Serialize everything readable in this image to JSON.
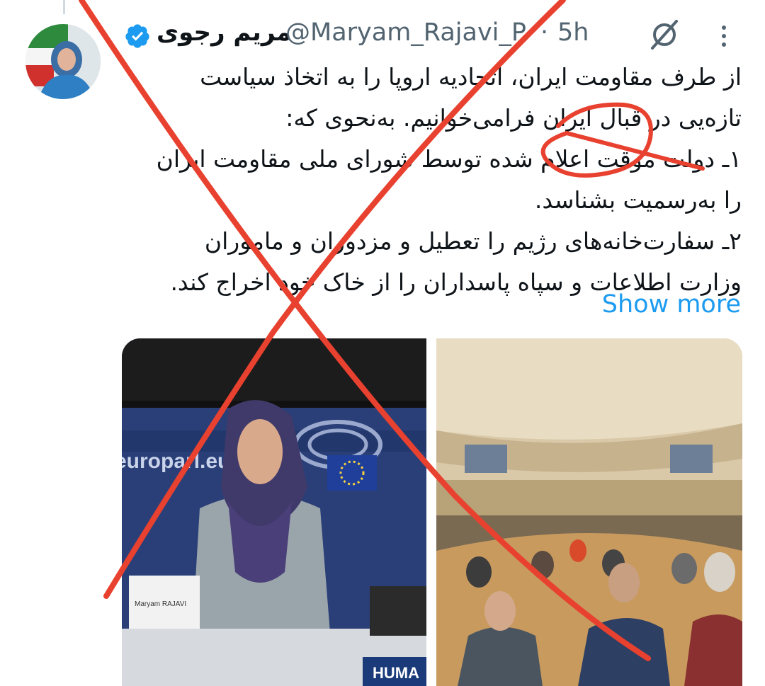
{
  "tweet": {
    "display_name": "مریم رجوی",
    "handle": "@Maryam_Rajavi_P",
    "separator": "·",
    "time": "5h",
    "text": "از طرف مقاومت ایران، اتحادیه اروپا را به اتخاذ سیاست\nتازه‌یی در قبال ایران فرامی‌خوانیم. به‌نحوی که:\n۱ـ دولت موقت اعلام شده توسط شورای ملی مقاومت ایران\nرا به‌رسمیت بشناسد.\n۲ـ سفارت‌خانه‌های رژیم را تعطیل و مزدوران و ماموران\nوزارت اطلاعات و سپاه پاسداران را از خاک خود اخراج کند.",
    "show_more": "Show more"
  },
  "media": {
    "left_image": {
      "backdrop_text": "europarl.eu",
      "nameplate": "Maryam RAJAVI",
      "banner_text": "HUMA"
    }
  },
  "icons": {
    "verified": "verified-badge-icon",
    "grok": "grok-icon",
    "more": "more-options-icon"
  },
  "colors": {
    "accent": "#1d9bf0",
    "secondary_text": "#536471",
    "overlay_red": "#e8412f"
  }
}
